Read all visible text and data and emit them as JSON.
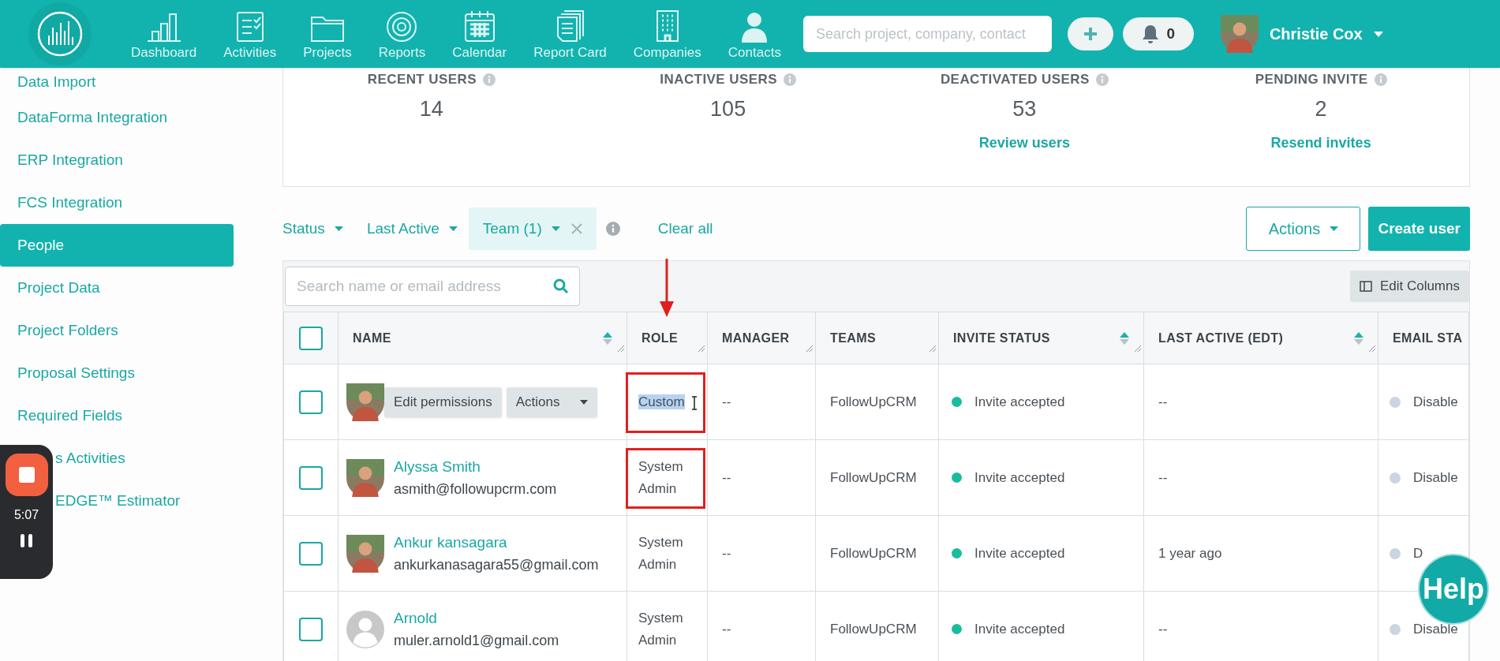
{
  "top_nav": {
    "items": [
      {
        "label": "Dashboard",
        "selected": false
      },
      {
        "label": "Activities",
        "selected": false
      },
      {
        "label": "Projects",
        "selected": false
      },
      {
        "label": "Reports",
        "selected": false
      },
      {
        "label": "Calendar",
        "selected": false
      },
      {
        "label": "Report Card",
        "selected": false
      },
      {
        "label": "Companies",
        "selected": false
      },
      {
        "label": "Contacts",
        "selected": false
      }
    ],
    "search": {
      "placeholder": "Search project, company, contact"
    },
    "notifications": "0",
    "user": "Christie Cox"
  },
  "sidebar": {
    "items": [
      {
        "label": "Data Import",
        "selected": false
      },
      {
        "label": "DataForma Integration",
        "selected": false
      },
      {
        "label": "ERP Integration",
        "selected": false
      },
      {
        "label": "FCS Integration",
        "selected": false
      },
      {
        "label": "People",
        "selected": true
      },
      {
        "label": "Project Data",
        "selected": false
      },
      {
        "label": "Project Folders",
        "selected": false
      },
      {
        "label": "Proposal Settings",
        "selected": false
      },
      {
        "label": "Required Fields",
        "selected": false
      },
      {
        "label": "s Activities",
        "selected": false
      },
      {
        "label": "EDGE™ Estimator",
        "selected": false
      }
    ]
  },
  "stats": [
    {
      "label": "RECENT USERS",
      "value": "14"
    },
    {
      "label": "INACTIVE USERS",
      "value": "105"
    },
    {
      "label": "DEACTIVATED USERS",
      "value": "53",
      "link": "Review users"
    },
    {
      "label": "PENDING INVITE",
      "value": "2",
      "link": "Resend invites"
    }
  ],
  "filters": [
    {
      "label": "Status",
      "active": false
    },
    {
      "label": "Last Active",
      "active": false
    },
    {
      "label": "Team (1)",
      "active": true
    }
  ],
  "clear_all": "Clear all",
  "actions_button": "Actions",
  "create_button": "Create user",
  "table_search": {
    "placeholder": "Search name or email address"
  },
  "edit_columns": "Edit Columns",
  "table": {
    "all_checked": false,
    "columns": [
      {
        "label": "NAME",
        "sortable": true
      },
      {
        "label": "ROLE",
        "sortable": false
      },
      {
        "label": "MANAGER",
        "sortable": false
      },
      {
        "label": "TEAMS",
        "sortable": false
      },
      {
        "label": "INVITE STATUS",
        "sortable": true
      },
      {
        "label": "LAST ACTIVE (EDT)",
        "sortable": true
      },
      {
        "label": "EMAIL STA"
      }
    ],
    "rows": [
      {
        "checked": false,
        "hover_actions": [
          "Edit permissions",
          "Actions"
        ],
        "role": "Custom",
        "role_selected": true,
        "role_marked": true,
        "manager": "--",
        "teams": "FollowUpCRM",
        "invite_status": {
          "label": "Invite accepted",
          "color": "#1abc9c"
        },
        "last_active": "--",
        "email_status": {
          "label": "Disable",
          "color": "#cbd5e1"
        }
      },
      {
        "checked": false,
        "name": "Alyssa Smith",
        "email": "asmith@followupcrm.com",
        "role": "System Admin",
        "role_selected": false,
        "role_marked": true,
        "manager": "--",
        "teams": "FollowUpCRM",
        "invite_status": {
          "label": "Invite accepted",
          "color": "#1abc9c"
        },
        "last_active": "--",
        "email_status": {
          "label": "Disable",
          "color": "#cbd5e1"
        }
      },
      {
        "checked": false,
        "name": "Ankur kansagara",
        "email": "ankurkanasagara55@gmail.com",
        "role": "System Admin",
        "role_selected": false,
        "role_marked": false,
        "manager": "--",
        "teams": "FollowUpCRM",
        "invite_status": {
          "label": "Invite accepted",
          "color": "#1abc9c"
        },
        "last_active": "1 year ago",
        "email_status": {
          "label": "D",
          "color": "#cbd5e1"
        }
      },
      {
        "checked": false,
        "name": "Arnold",
        "email": "muler.arnold1@gmail.com",
        "role": "System Admin",
        "role_selected": false,
        "role_marked": false,
        "manager": "--",
        "teams": "FollowUpCRM",
        "invite_status": {
          "label": "Invite accepted",
          "color": "#1abc9c"
        },
        "last_active": "--",
        "email_status": {
          "label": "Disable",
          "color": "#cbd5e1"
        }
      }
    ]
  },
  "recorder": {
    "time": "5:07"
  },
  "help": "Help"
}
